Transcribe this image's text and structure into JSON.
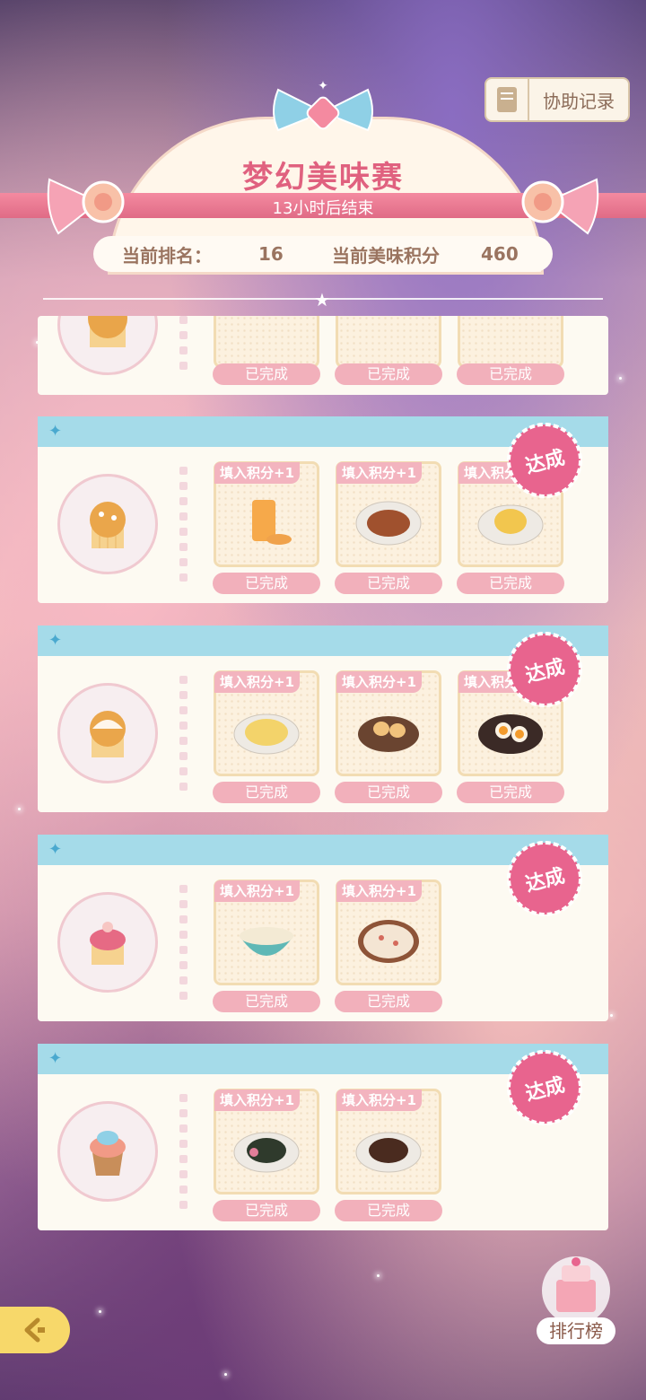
{
  "header": {
    "title": "梦幻美味赛",
    "subtitle": "13小时后结束",
    "record_button": "协助记录",
    "rank_label": "当前排名：",
    "rank_value": "16",
    "score_label": "当前美味积分",
    "score_value": "460"
  },
  "cards": [
    {
      "badge": "",
      "dishes": [
        {
          "tag": "",
          "status": "已完成"
        },
        {
          "tag": "",
          "status": "已完成"
        },
        {
          "tag": "",
          "status": "已完成"
        }
      ]
    },
    {
      "badge": "达成",
      "dishes": [
        {
          "tag": "填入积分+1",
          "status": "已完成"
        },
        {
          "tag": "填入积分+1",
          "status": "已完成"
        },
        {
          "tag": "填入积分+1",
          "status": "已完成"
        }
      ]
    },
    {
      "badge": "达成",
      "dishes": [
        {
          "tag": "填入积分+1",
          "status": "已完成"
        },
        {
          "tag": "填入积分+1",
          "status": "已完成"
        },
        {
          "tag": "填入积分+1",
          "status": "已完成"
        }
      ]
    },
    {
      "badge": "达成",
      "dishes": [
        {
          "tag": "填入积分+1",
          "status": "已完成"
        },
        {
          "tag": "填入积分+1",
          "status": "已完成"
        }
      ]
    },
    {
      "badge": "达成",
      "dishes": [
        {
          "tag": "填入积分+1",
          "status": "已完成"
        },
        {
          "tag": "填入积分+1",
          "status": "已完成"
        }
      ]
    }
  ],
  "leaderboard_button": "排行榜",
  "colors": {
    "accent_pink": "#e0617f",
    "card_bar": "#a5dbe9",
    "badge": "#e8648e",
    "done_pill": "#f2b0bb"
  }
}
